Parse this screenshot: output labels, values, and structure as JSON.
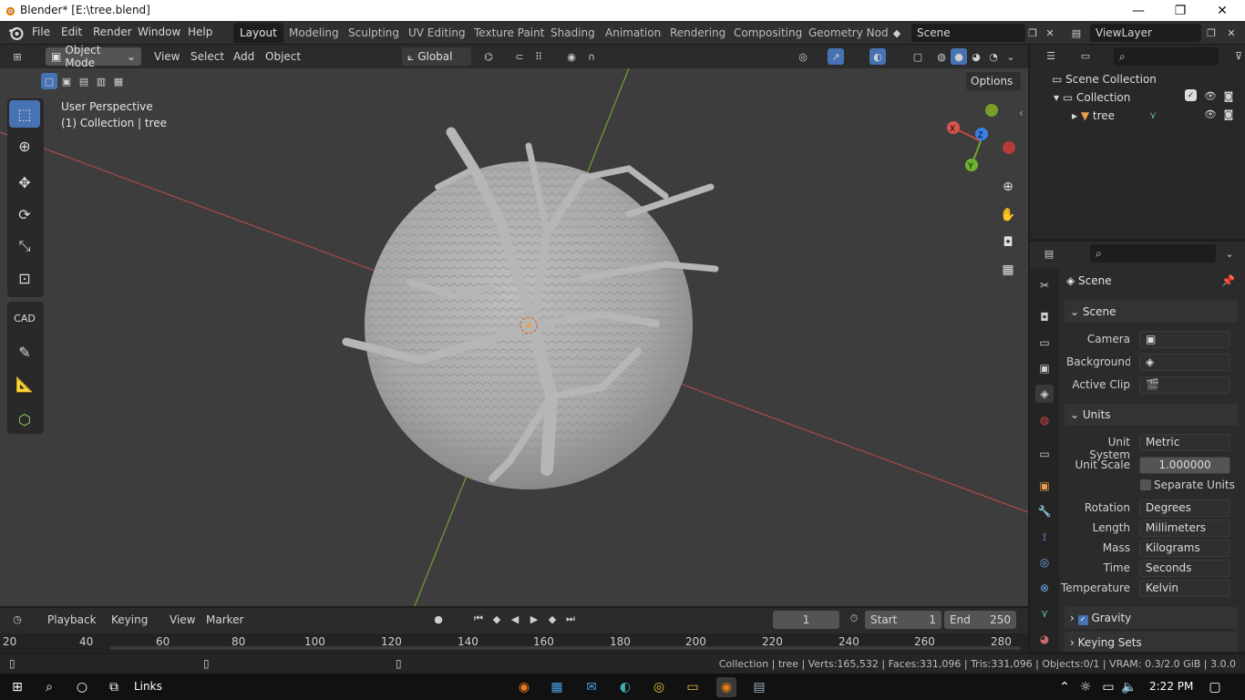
{
  "window": {
    "title": "Blender* [E:\\tree.blend]",
    "minimize": "—",
    "restore": "❐",
    "close": "✕"
  },
  "menu": [
    "File",
    "Edit",
    "Render",
    "Window",
    "Help"
  ],
  "workspaces": [
    "Layout",
    "Modeling",
    "Sculpting",
    "UV Editing",
    "Texture Paint",
    "Shading",
    "Animation",
    "Rendering",
    "Compositing",
    "Geometry Nod"
  ],
  "scene_field": "Scene",
  "viewlayer_field": "ViewLayer",
  "viewport_header": {
    "mode": "Object Mode",
    "menus": [
      "View",
      "Select",
      "Add",
      "Object"
    ],
    "orientation": "Global",
    "options": "Options"
  },
  "viewport_overlay": {
    "line1": "User Perspective",
    "line2": "(1) Collection | tree"
  },
  "gizmo": {
    "x": "X",
    "y": "Y",
    "z": "Z"
  },
  "tools": {
    "cad": "CAD"
  },
  "outliner": {
    "root": "Scene Collection",
    "collection": "Collection",
    "object": "tree"
  },
  "properties": {
    "header": "Scene",
    "scene_section": "Scene",
    "camera_label": "Camera",
    "background_label": "Background...",
    "active_clip_label": "Active Clip",
    "units_section": "Units",
    "unit_system_label": "Unit System",
    "unit_system": "Metric",
    "unit_scale_label": "Unit Scale",
    "unit_scale": "1.000000",
    "separate_units": "Separate Units",
    "rotation_label": "Rotation",
    "rotation": "Degrees",
    "length_label": "Length",
    "length": "Millimeters",
    "mass_label": "Mass",
    "mass": "Kilograms",
    "time_label": "Time",
    "time": "Seconds",
    "temperature_label": "Temperature",
    "temperature": "Kelvin",
    "gravity": "Gravity",
    "keying_sets": "Keying Sets"
  },
  "timeline": {
    "menus": [
      "Playback",
      "Keying",
      "View",
      "Marker"
    ],
    "current_frame": "1",
    "start_label": "Start",
    "start": "1",
    "end_label": "End",
    "end": "250",
    "ruler": [
      "20",
      "40",
      "60",
      "80",
      "100",
      "120",
      "140",
      "160",
      "180",
      "200",
      "220",
      "240",
      "260",
      "280"
    ]
  },
  "status": "Collection | tree | Verts:165,532 | Faces:331,096 | Tris:331,096 | Objects:0/1 | VRAM: 0.3/2.0 GiB | 3.0.0",
  "taskbar": {
    "links": "Links",
    "time": "2:22 PM"
  },
  "colors": {
    "accent": "#4772b3",
    "axis_x": "#e05050",
    "axis_y": "#8cc43c",
    "axis_z": "#3c82e0",
    "viewport_bg": "#3d3d3d"
  }
}
